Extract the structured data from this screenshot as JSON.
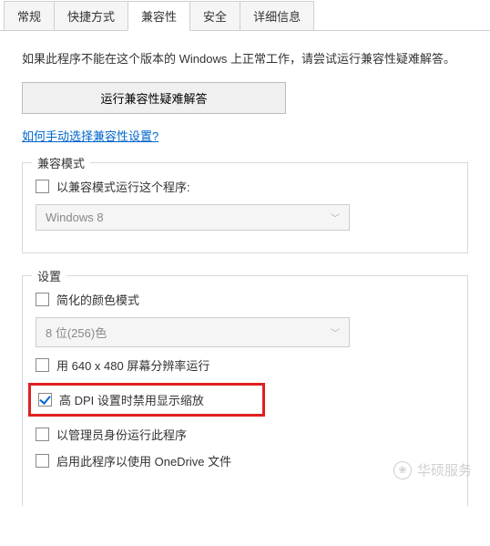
{
  "tabs": {
    "general": "常规",
    "shortcut": "快捷方式",
    "compatibility": "兼容性",
    "security": "安全",
    "details": "详细信息"
  },
  "intro": "如果此程序不能在这个版本的 Windows 上正常工作，请尝试运行兼容性疑难解答。",
  "troubleshoot_btn": "运行兼容性疑难解答",
  "manual_link": "如何手动选择兼容性设置?",
  "compat_mode": {
    "title": "兼容模式",
    "run_label": "以兼容模式运行这个程序:",
    "os_value": "Windows 8"
  },
  "settings": {
    "title": "设置",
    "reduced_color": "简化的颜色模式",
    "color_value": "8 位(256)色",
    "res_640": "用 640 x 480 屏幕分辨率运行",
    "disable_dpi": "高 DPI 设置时禁用显示缩放",
    "run_admin": "以管理员身份运行此程序",
    "onedrive": "启用此程序以使用 OneDrive 文件"
  },
  "watermark": "华硕服务"
}
